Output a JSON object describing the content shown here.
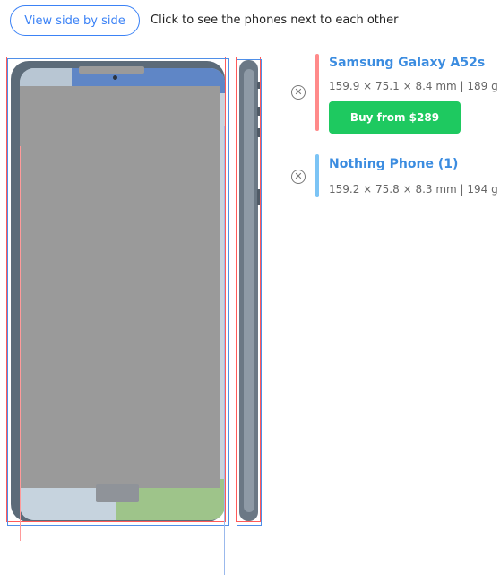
{
  "toolbar": {
    "view_side_by_side_label": "View side by side",
    "hint": "Click to see the phones next to each other"
  },
  "phones": [
    {
      "name": "Samsung Galaxy A52s",
      "specs": "159.9 × 75.1 × 8.4 mm | 189 g",
      "buy_label": "Buy from $289",
      "accent_color": "#ff8a8a"
    },
    {
      "name": "Nothing Phone (1)",
      "specs": "159.2 × 75.8 × 8.3 mm | 194 g",
      "accent_color": "#7cc4f5"
    }
  ],
  "colors": {
    "link_blue": "#3b8ce0",
    "buy_green": "#1ec960",
    "outline_red": "#ff5a5a",
    "outline_blue": "#4f8fe8"
  },
  "icons": {
    "remove": "remove-circle-icon"
  }
}
